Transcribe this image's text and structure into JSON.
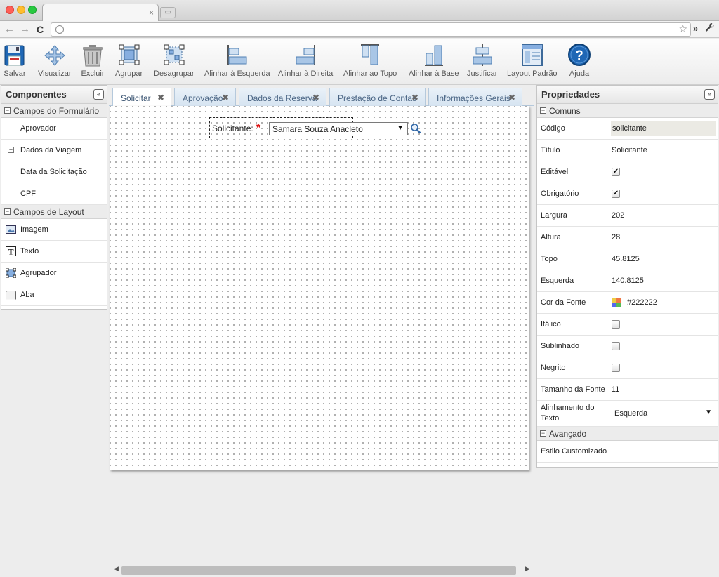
{
  "browser": {
    "tab_close": "×",
    "newtab": "▭",
    "back": "←",
    "forward": "→",
    "reload": "C",
    "url": "",
    "star": "☆",
    "more": "»",
    "wrench": "🔧"
  },
  "toolbar": {
    "buttons": [
      {
        "label": "Salvar",
        "icon": "save-icon"
      },
      {
        "label": "Visualizar",
        "icon": "move-icon"
      },
      {
        "label": "Excluir",
        "icon": "trash-icon"
      },
      {
        "label": "Agrupar",
        "icon": "group-icon"
      },
      {
        "label": "Desagrupar",
        "icon": "ungroup-icon"
      },
      {
        "label": "Alinhar à Esquerda",
        "icon": "align-left-icon"
      },
      {
        "label": "Alinhar à Direita",
        "icon": "align-right-icon"
      },
      {
        "label": "Alinhar ao Topo",
        "icon": "align-top-icon"
      },
      {
        "label": "Alinhar à Base",
        "icon": "align-bottom-icon"
      },
      {
        "label": "Justificar",
        "icon": "justify-icon"
      },
      {
        "label": "Layout Padrão",
        "icon": "layout-icon"
      },
      {
        "label": "Ajuda",
        "icon": "help-icon"
      }
    ]
  },
  "components": {
    "title": "Componentes",
    "collapse": "«",
    "form_section": "Campos do Formulário",
    "form_items": [
      "Aprovador",
      "Dados da Viagem",
      "Data da Solicitação",
      "CPF"
    ],
    "layout_section": "Campos de Layout",
    "layout_items": [
      "Imagem",
      "Texto",
      "Agrupador",
      "Aba"
    ],
    "minus": "−",
    "plus": "+"
  },
  "form_tabs": [
    {
      "label": "Solicitar"
    },
    {
      "label": "Aprovação"
    },
    {
      "label": "Dados da Reserva"
    },
    {
      "label": "Prestação de Contas"
    },
    {
      "label": "Informações Gerais"
    }
  ],
  "tab_close": "✖",
  "field": {
    "label": "Solicitante:",
    "required_mark": "*",
    "value": "Samara Souza Anacleto",
    "arrow": "▼"
  },
  "scroll": {
    "left": "◀",
    "right": "▶"
  },
  "properties": {
    "title": "Propriedades",
    "expand": "»",
    "section_common": "Comuns",
    "rows": {
      "codigo": {
        "name": "Código",
        "value": "solicitante"
      },
      "titulo": {
        "name": "Título",
        "value": "Solicitante"
      },
      "editavel": {
        "name": "Editável",
        "checked": true,
        "mark": "✔"
      },
      "obrigatorio": {
        "name": "Obrigatório",
        "checked": true,
        "mark": "✔"
      },
      "largura": {
        "name": "Largura",
        "value": "202"
      },
      "altura": {
        "name": "Altura",
        "value": "28"
      },
      "topo": {
        "name": "Topo",
        "value": "45.8125"
      },
      "esquerda": {
        "name": "Esquerda",
        "value": "140.8125"
      },
      "cor_fonte": {
        "name": "Cor da Fonte",
        "value": "#222222"
      },
      "italico": {
        "name": "Itálico",
        "checked": false
      },
      "sublinhado": {
        "name": "Sublinhado",
        "checked": false
      },
      "negrito": {
        "name": "Negrito",
        "checked": false
      },
      "tamanho_fonte": {
        "name": "Tamanho da Fonte",
        "value": "11"
      },
      "alinhamento": {
        "name": "Alinhamento do Texto",
        "value": "Esquerda",
        "arrow": "▼"
      }
    },
    "section_advanced": "Avançado",
    "estilo": {
      "name": "Estilo Customizado"
    }
  },
  "colors": {
    "accent": "#1f74c9",
    "tab_text": "#4a6584",
    "required": "#dd1111"
  }
}
